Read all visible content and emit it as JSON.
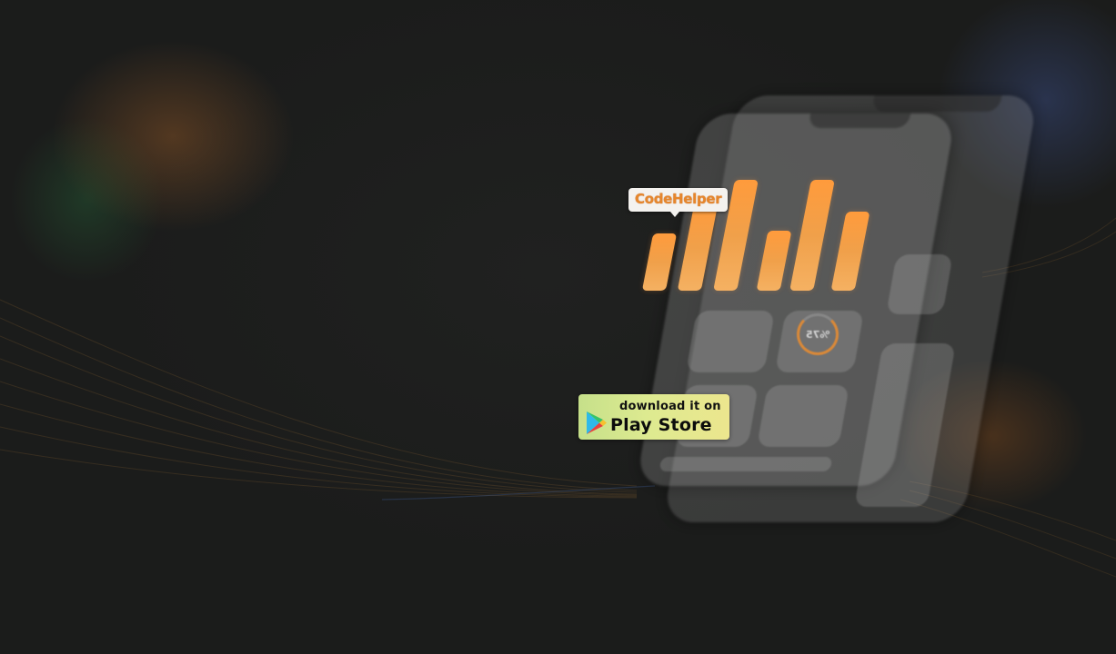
{
  "brand": {
    "name": "CodeHelper",
    "label_color": "#e6862c"
  },
  "mockup": {
    "gauge_text": "%75",
    "bar_color": "#f5a04a",
    "bars": [
      {
        "level": 0.52
      },
      {
        "level": 0.78
      },
      {
        "level": 1.0
      },
      {
        "level": 0.54
      },
      {
        "level": 1.0
      },
      {
        "level": 0.71
      }
    ]
  },
  "store_badge": {
    "small_text": "download it on",
    "big_text": "Play Store",
    "icon": "play-store-icon"
  }
}
